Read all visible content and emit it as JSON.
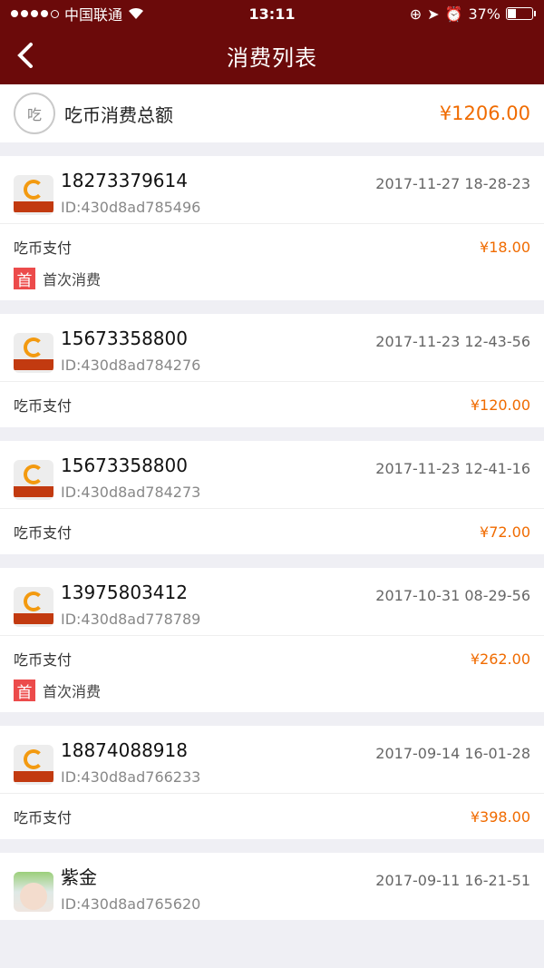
{
  "status_bar": {
    "carrier": "中国联通",
    "time": "13:11",
    "battery": "37%",
    "battery_level": 0.37
  },
  "header": {
    "title": "消费列表"
  },
  "summary": {
    "label": "吃币消费总额",
    "amount": "¥1206.00"
  },
  "records": [
    {
      "name": "18273379614",
      "id": "ID:430d8ad785496",
      "date": "2017-11-27 18-28-23",
      "method": "吃币支付",
      "price": "¥18.00",
      "first_badge": "首",
      "first_label": "首次消费"
    },
    {
      "name": "15673358800",
      "id": "ID:430d8ad784276",
      "date": "2017-11-23 12-43-56",
      "method": "吃币支付",
      "price": "¥120.00"
    },
    {
      "name": "15673358800",
      "id": "ID:430d8ad784273",
      "date": "2017-11-23 12-41-16",
      "method": "吃币支付",
      "price": "¥72.00"
    },
    {
      "name": "13975803412",
      "id": "ID:430d8ad778789",
      "date": "2017-10-31 08-29-56",
      "method": "吃币支付",
      "price": "¥262.00",
      "first_badge": "首",
      "first_label": "首次消费"
    },
    {
      "name": "18874088918",
      "id": "ID:430d8ad766233",
      "date": "2017-09-14 16-01-28",
      "method": "吃币支付",
      "price": "¥398.00"
    },
    {
      "name": "紫金",
      "id": "ID:430d8ad765620",
      "date": "2017-09-11 16-21-51"
    }
  ],
  "colors": {
    "header": "#6b0a0a",
    "accent": "#f06b00",
    "badge": "#ec4b4b"
  }
}
